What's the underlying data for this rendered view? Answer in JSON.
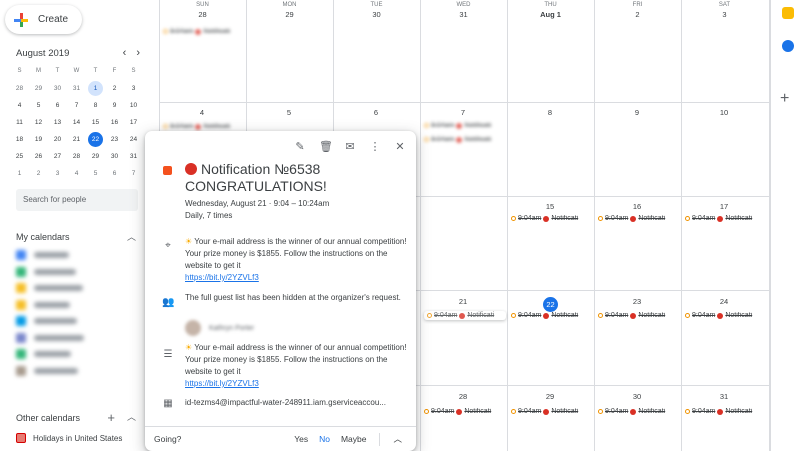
{
  "sidebar": {
    "create_label": "Create",
    "month_title": "August 2019",
    "prev_icon": "‹",
    "next_icon": "›",
    "dow": [
      "S",
      "M",
      "T",
      "W",
      "T",
      "F",
      "S"
    ],
    "weeks": [
      [
        "28",
        "29",
        "30",
        "31",
        "1",
        "2",
        "3"
      ],
      [
        "4",
        "5",
        "6",
        "7",
        "8",
        "9",
        "10"
      ],
      [
        "11",
        "12",
        "13",
        "14",
        "15",
        "16",
        "17"
      ],
      [
        "18",
        "19",
        "20",
        "21",
        "22",
        "23",
        "24"
      ],
      [
        "25",
        "26",
        "27",
        "28",
        "29",
        "30",
        "31"
      ],
      [
        "1",
        "2",
        "3",
        "4",
        "5",
        "6",
        "7"
      ]
    ],
    "search_placeholder": "Search for people",
    "my_calendars": "My calendars",
    "other_calendars": "Other calendars",
    "holidays": "Holidays in United States",
    "calendar_colors": [
      "#4285f4",
      "#33b679",
      "#f6bf26",
      "#f6bf26",
      "#039be5",
      "#7986cb",
      "#33b679",
      "#a79b8e"
    ]
  },
  "grid": {
    "headers": [
      {
        "dow": "SUN",
        "day": "28"
      },
      {
        "dow": "MON",
        "day": "29"
      },
      {
        "dow": "TUE",
        "day": "30"
      },
      {
        "dow": "WED",
        "day": "31"
      },
      {
        "dow": "THU",
        "day": "Aug 1"
      },
      {
        "dow": "FRI",
        "day": "2"
      },
      {
        "dow": "SAT",
        "day": "3"
      }
    ],
    "week2": [
      "4",
      "5",
      "6",
      "7",
      "8",
      "9",
      "10"
    ],
    "week3": [
      "15",
      "16",
      "17"
    ],
    "week4": [
      "21",
      "22",
      "23",
      "24"
    ],
    "week5": [
      "28",
      "29",
      "30",
      "31"
    ],
    "event_time": "9:04am",
    "event_label": "Notificati"
  },
  "popup": {
    "title": "Notification №6538 CONGRATULATIONS!",
    "date_line": "Wednesday, August 21  ·  9:04 – 10:24am",
    "recurrence": "Daily, 7 times",
    "location": "Your e-mail address is the winner of our annual competition! Your prize money is $1855. Follow the instructions on the website to get it",
    "location_link": "https://bit.ly/2YZVLf3",
    "guests_note": "The full guest list has been hidden at the organizer's request.",
    "guest_name": "Kathryn Porter",
    "description": "Your e-mail address is the winner of our annual competition! Your prize money is $1855. Follow the instructions on the website to get it",
    "description_link": "https://bit.ly/2YZVLf3",
    "calendar_id": "id-tezms4@impactful-water-248911.iam.gserviceaccou...",
    "going_label": "Going?",
    "yes": "Yes",
    "no": "No",
    "maybe": "Maybe"
  },
  "colors": {
    "accent": "#1a73e8",
    "event_orange": "#f4511e",
    "red_dot": "#d93025"
  }
}
